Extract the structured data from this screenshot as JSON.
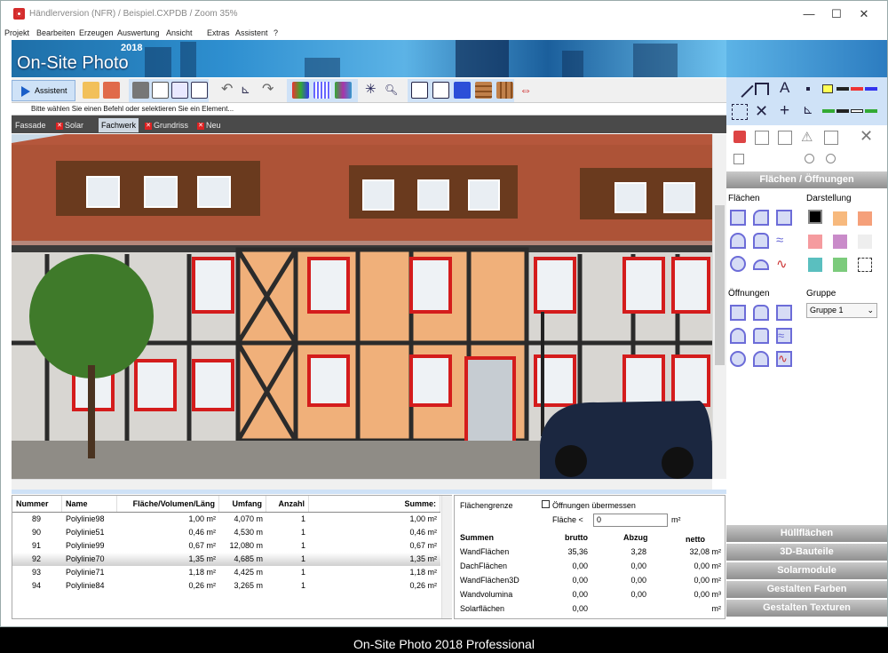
{
  "window": {
    "title": "Händlerversion (NFR) / Beispiel.CXPDB / Zoom 35%",
    "min": "—",
    "max": "☐",
    "close": "✕"
  },
  "menu": [
    "Projekt",
    "Bearbeiten",
    "Erzeugen",
    "Auswertung",
    "Ansicht",
    "Extras",
    "Assistent",
    "?"
  ],
  "banner": {
    "logo": "On-Site Photo",
    "year": "2018"
  },
  "toolbar": {
    "assistant": "Assistent"
  },
  "status": "Bitte wählen Sie einen Befehl oder selektieren Sie ein Element...",
  "tabs": [
    {
      "label": "Fassade",
      "closable": false
    },
    {
      "label": "Solar",
      "closable": true
    },
    {
      "label": "Fachwerk",
      "closable": false,
      "active": true
    },
    {
      "label": "Grundriss",
      "closable": true
    },
    {
      "label": "Neu",
      "closable": true
    }
  ],
  "table": {
    "headers": [
      "Nummer",
      "Name",
      "Fläche/Volumen/Läng",
      "Umfang",
      "Anzahl",
      "Summe:"
    ],
    "rows": [
      [
        "89",
        "Polylinie98",
        "1,00 m²",
        "4,070 m",
        "1",
        "1,00 m²"
      ],
      [
        "90",
        "Polylinie51",
        "0,46 m²",
        "4,530 m",
        "1",
        "0,46 m²"
      ],
      [
        "91",
        "Polylinie99",
        "0,67 m²",
        "12,080 m",
        "1",
        "0,67 m²"
      ],
      [
        "92",
        "Polylinie70",
        "1,35 m²",
        "4,685 m",
        "1",
        "1,35 m²"
      ],
      [
        "93",
        "Polylinie71",
        "1,18 m²",
        "4,425 m",
        "1",
        "1,18 m²"
      ],
      [
        "94",
        "Polylinie84",
        "0,26 m²",
        "3,265 m",
        "1",
        "0,26 m²"
      ]
    ],
    "selected_row": 3
  },
  "sums": {
    "flaechengrenze": "Flächengrenze",
    "oeffnungen_label": "Öffnungen übermessen",
    "flaeche_label": "Fläche <",
    "flaeche_value": "0",
    "unit": "m²",
    "headers": [
      "Summen",
      "brutto",
      "Abzug",
      "netto"
    ],
    "rows": [
      [
        "WandFlächen",
        "35,36",
        "3,28",
        "32,08 m²"
      ],
      [
        "DachFlächen",
        "0,00",
        "0,00",
        "0,00 m²"
      ],
      [
        "WandFlächen3D",
        "0,00",
        "0,00",
        "0,00 m²"
      ],
      [
        "Wandvolumina",
        "0,00",
        "0,00",
        "0,00 m³"
      ],
      [
        "Solarflächen",
        "0,00",
        "",
        "m²"
      ]
    ]
  },
  "rightpanel": {
    "header": "Flächen / Öffnungen",
    "flaechen": "Flächen",
    "darstellung": "Darstellung",
    "oeffnungen": "Öffnungen",
    "gruppe": "Gruppe",
    "gruppe_value": "Gruppe 1",
    "text_tool": "A",
    "buttons": [
      "Hüllflächen",
      "3D-Bauteile",
      "Solarmodule",
      "Gestalten Farben",
      "Gestalten Texturen"
    ],
    "swatches": [
      "#000000",
      "#f7b97d",
      "#f5a07a",
      "#f59b9f",
      "#c98bc9",
      "#eeeeee",
      "#5abfbf",
      "#7ccb7c",
      "#ffffff"
    ]
  },
  "footer": "On-Site Photo 2018 Professional"
}
